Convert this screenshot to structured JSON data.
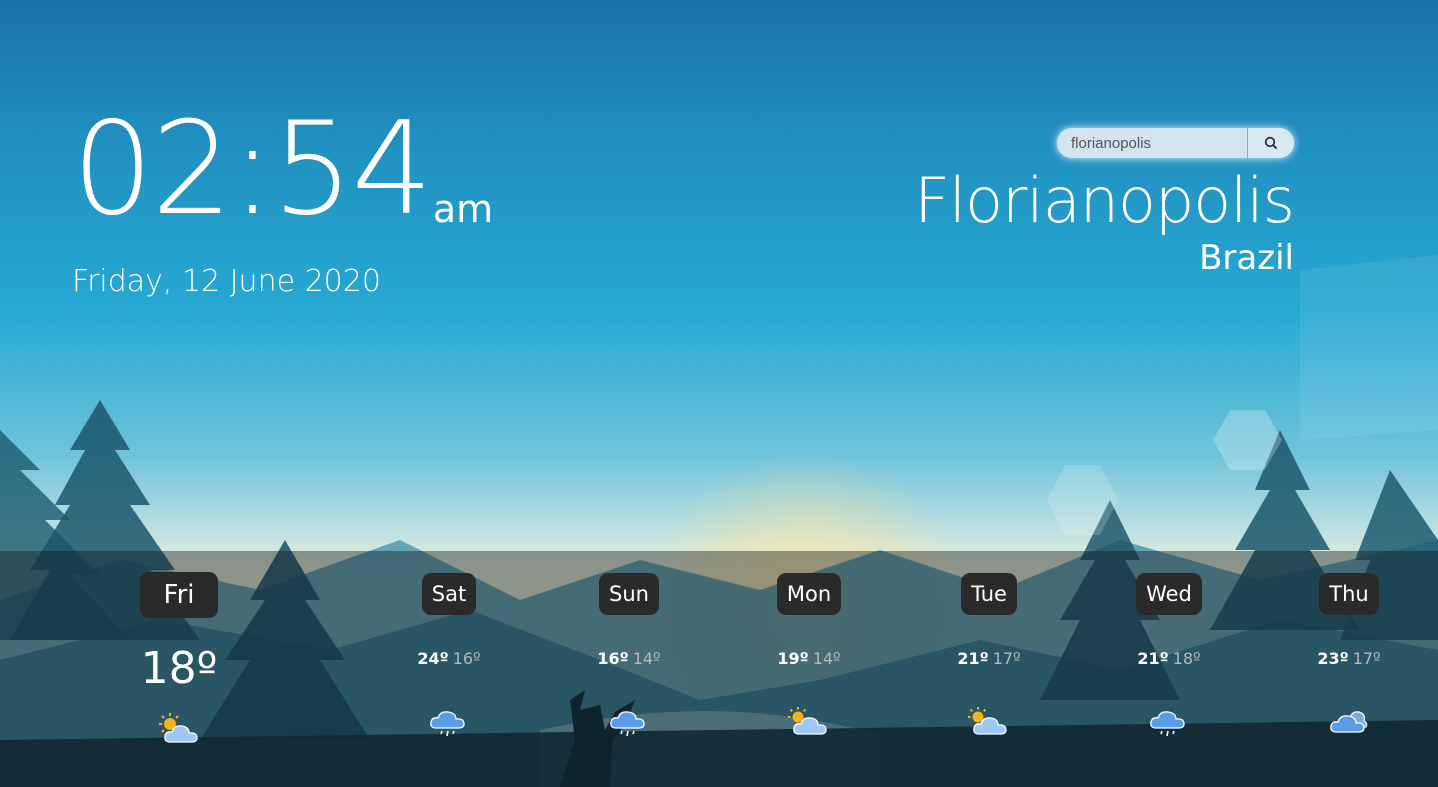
{
  "clock": {
    "time": "02:54",
    "ampm": "am",
    "date": "Friday, 12 June 2020"
  },
  "search": {
    "value": "florianopolis",
    "icon": "search-icon"
  },
  "location": {
    "city": "Florianopolis",
    "country": "Brazil"
  },
  "today": {
    "day": "Fri",
    "temp": "18º",
    "icon": "partly-cloudy-icon"
  },
  "forecast": [
    {
      "day": "Sat",
      "high": "24º",
      "low": "16º",
      "icon": "rain-cloud-icon"
    },
    {
      "day": "Sun",
      "high": "16º",
      "low": "14º",
      "icon": "rain-cloud-icon"
    },
    {
      "day": "Mon",
      "high": "19º",
      "low": "14º",
      "icon": "partly-cloudy-icon"
    },
    {
      "day": "Tue",
      "high": "21º",
      "low": "17º",
      "icon": "partly-cloudy-icon"
    },
    {
      "day": "Wed",
      "high": "21º",
      "low": "18º",
      "icon": "rain-cloud-icon"
    },
    {
      "day": "Thu",
      "high": "23º",
      "low": "17º",
      "icon": "cloudy-icon"
    }
  ]
}
